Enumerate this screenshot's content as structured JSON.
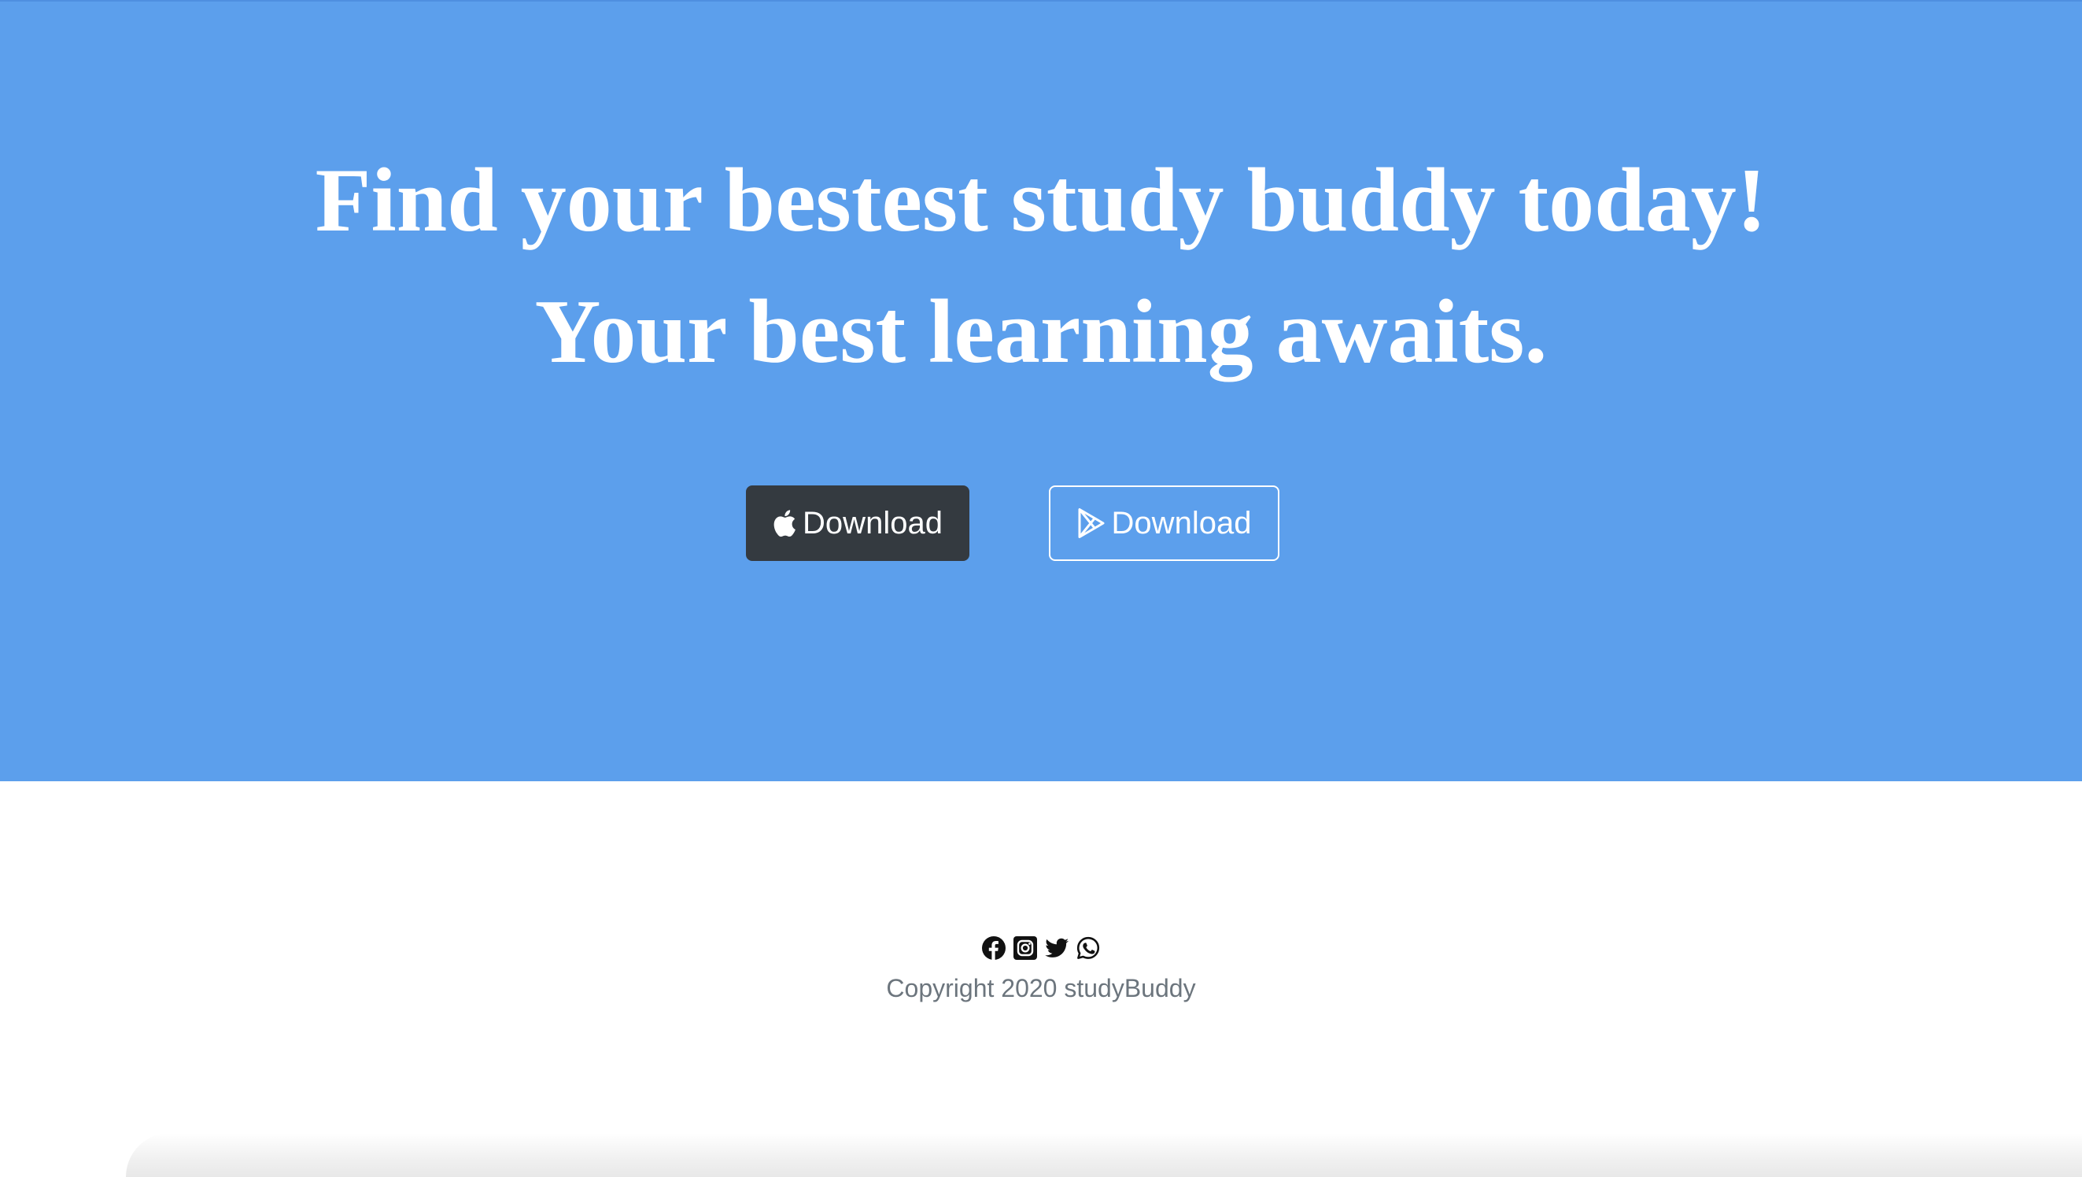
{
  "hero": {
    "headline_line1": "Find your bestest study buddy today!",
    "headline_line2": "Your best learning awaits.",
    "background_color": "#5c9fec"
  },
  "buttons": {
    "apple": {
      "label": "Download",
      "icon": "apple-icon"
    },
    "play": {
      "label": "Download",
      "icon": "google-play-icon"
    }
  },
  "footer": {
    "social_icons": [
      "facebook-icon",
      "instagram-icon",
      "twitter-icon",
      "whatsapp-icon"
    ],
    "copyright": "Copyright 2020 studyBuddy"
  }
}
